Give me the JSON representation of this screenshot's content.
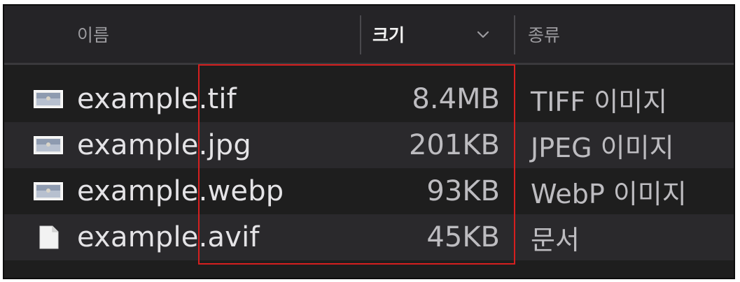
{
  "header": {
    "name_label": "이름",
    "size_label": "크기",
    "kind_label": "종류",
    "sort_icon": "chevron-down-icon"
  },
  "files": [
    {
      "name": "example.tif",
      "size": "8.4MB",
      "kind": "TIFF 이미지",
      "icon": "image-thumbnail-icon"
    },
    {
      "name": "example.jpg",
      "size": "201KB",
      "kind": "JPEG 이미지",
      "icon": "image-thumbnail-icon"
    },
    {
      "name": "example.webp",
      "size": "93KB",
      "kind": "WebP 이미지",
      "icon": "image-thumbnail-icon"
    },
    {
      "name": "example.avif",
      "size": "45KB",
      "kind": "문서",
      "icon": "document-icon"
    }
  ],
  "colors": {
    "background": "#1e1e1e",
    "header_bg": "#252427",
    "alt_row": "#2a292c",
    "highlight_box": "#d61f1f"
  }
}
